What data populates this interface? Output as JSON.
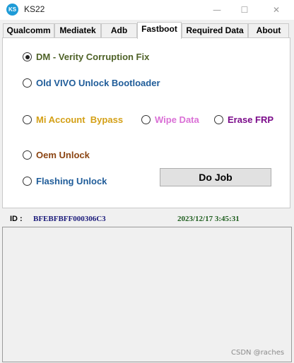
{
  "window": {
    "title": "KS22",
    "icon_text": "KS",
    "controls": {
      "minimize": "—",
      "maximize": "☐",
      "close": "✕"
    }
  },
  "tabs": [
    {
      "label": "Qualcomm",
      "active": false
    },
    {
      "label": "Mediatek",
      "active": false
    },
    {
      "label": "Adb",
      "active": false
    },
    {
      "label": "Fastboot",
      "active": true
    },
    {
      "label": "Required  Data",
      "active": false
    },
    {
      "label": "About",
      "active": false
    }
  ],
  "options": {
    "dm_verity": {
      "label": "DM - Verity Corruption Fix",
      "checked": true,
      "color": "#4f6228"
    },
    "old_vivo": {
      "label": "Old VIVO Unlock Bootloader",
      "checked": false,
      "color": "#1f5c99"
    },
    "mi_account": {
      "label": "Mi Account  Bypass",
      "checked": false,
      "color": "#d4a017"
    },
    "wipe_data": {
      "label": "Wipe Data",
      "checked": false,
      "color": "#da70d6"
    },
    "erase_frp": {
      "label": "Erase FRP",
      "checked": false,
      "color": "#7b0b8a"
    },
    "oem_unlock": {
      "label": "Oem Unlock",
      "checked": false,
      "color": "#8b4513"
    },
    "flashing_unlock": {
      "label": "Flashing Unlock",
      "checked": false,
      "color": "#1f5c99"
    }
  },
  "do_job_label": "Do Job",
  "status": {
    "id_label": "ID :",
    "id_value": "BFEBFBFF000306C3",
    "datetime": "2023/12/17 3:45:31"
  },
  "watermark": "CSDN @raches"
}
